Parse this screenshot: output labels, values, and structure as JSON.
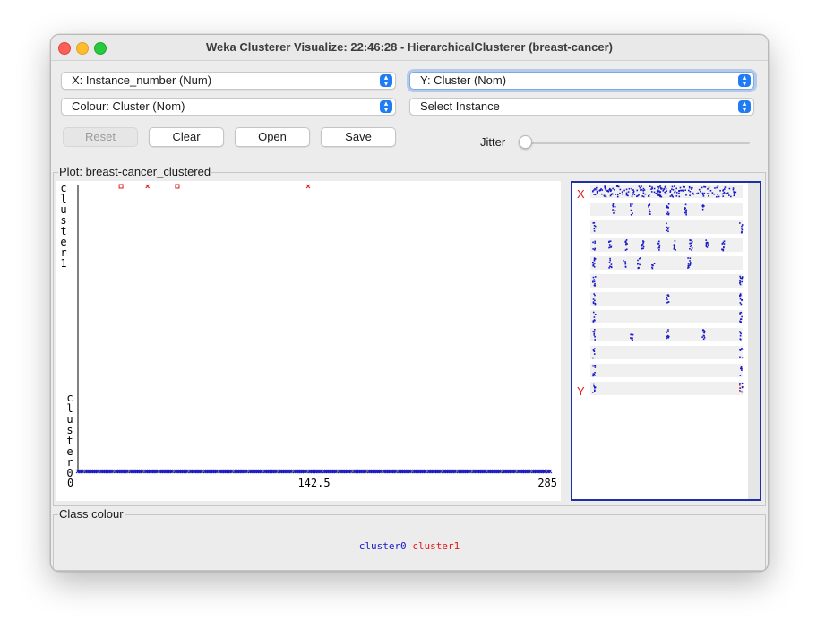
{
  "window": {
    "title": "Weka Clusterer Visualize: 22:46:28 - HierarchicalClusterer (breast-cancer)"
  },
  "controls": {
    "x_axis": "X: Instance_number (Num)",
    "y_axis": "Y: Cluster (Nom)",
    "colour": "Colour: Cluster (Nom)",
    "select": "Select Instance",
    "buttons": {
      "reset": "Reset",
      "clear": "Clear",
      "open": "Open",
      "save": "Save"
    },
    "jitter_label": "Jitter",
    "jitter_value": 0
  },
  "plot": {
    "group_label": "Plot: breast-cancer_clustered",
    "y_top_label": "cluster1",
    "y_bottom_label": "cluster0",
    "x_ticks": [
      "0",
      "142.5",
      "285"
    ]
  },
  "matrix": {
    "x_marker": "X",
    "y_marker": "Y"
  },
  "class_colour": {
    "label": "Class colour",
    "items": [
      {
        "name": "cluster0",
        "color": "#1818c8"
      },
      {
        "name": "cluster1",
        "color": "#e01818"
      }
    ]
  },
  "chart_data": {
    "type": "scatter",
    "title": "",
    "xlabel": "Instance_number",
    "ylabel": "Cluster",
    "xlim": [
      0,
      285
    ],
    "categories_y": [
      "cluster0",
      "cluster1"
    ],
    "series": [
      {
        "name": "cluster1",
        "color": "#e01818",
        "points": [
          [
            26,
            "cluster1",
            "square"
          ],
          [
            42,
            "cluster1",
            "cross"
          ],
          [
            60,
            "cluster1",
            "square"
          ],
          [
            139,
            "cluster1",
            "cross"
          ]
        ]
      },
      {
        "name": "cluster0",
        "color": "#1818c8",
        "x_range": [
          0,
          285
        ],
        "y": "cluster0"
      }
    ]
  }
}
